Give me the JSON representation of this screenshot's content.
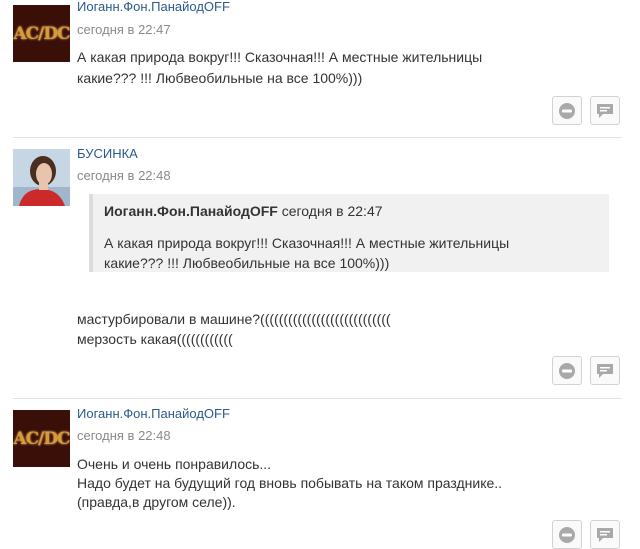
{
  "comments": [
    {
      "author": "Иоганн.Фон.ПанайодOFF",
      "date": "сегодня в 22:47",
      "avatar_text": "AC/DC",
      "lines": [
        "А какая природа вокруг!!! Сказочная!!! А местные жительницы",
        "какие??? !!! Любвеобильные на все 100%)))"
      ]
    },
    {
      "author": "БУСИНКА",
      "date": "сегодня в 22:48",
      "quote": {
        "author": "Иоганн.Фон.ПанайодOFF",
        "date": "сегодня в 22:47",
        "lines": [
          "А какая природа вокруг!!! Сказочная!!! А местные жительницы",
          "какие??? !!! Любвеобильные на все 100%)))"
        ]
      },
      "lines": [
        "мастурбировали в машине?((((((((((((((((((((((((((((",
        "мерзость какая(((((((((((("
      ]
    },
    {
      "author": "Иоганн.Фон.ПанайодOFF",
      "date": "сегодня в 22:48",
      "avatar_text": "AC/DC",
      "lines": [
        "Очень и очень понравилось...",
        "Надо будет на будущий год вновь побывать на таком празднике..",
        "(правда,в другом селе))."
      ]
    }
  ],
  "icons": {
    "block": "block-icon",
    "reply": "reply-icon"
  },
  "colors": {
    "author_link": "#2b5a8c",
    "date": "#8a8a8a",
    "quote_bg": "#f1f1f1"
  }
}
